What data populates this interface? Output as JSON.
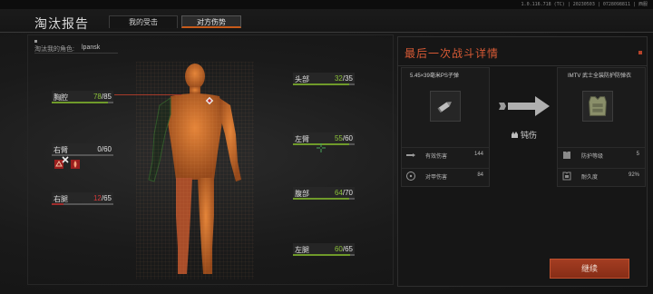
{
  "build_info": "1.0.116.718 (TC) | 20230503 | 0728098811 | 西服",
  "header": {
    "title": "淘汰报告",
    "tabs": [
      {
        "label": "我的受击",
        "active": false
      },
      {
        "label": "对方伤势",
        "active": true
      }
    ]
  },
  "killer": {
    "label": "淘汰我的角色:",
    "name": "lpansk"
  },
  "body_parts": [
    {
      "id": "chest",
      "label": "胸腔",
      "current": 78,
      "max": 85,
      "current_text": "78",
      "max_text": "/85",
      "state": "ok"
    },
    {
      "id": "head",
      "label": "头部",
      "current": 32,
      "max": 35,
      "current_text": "32",
      "max_text": "/35",
      "state": "ok"
    },
    {
      "id": "right_arm",
      "label": "右臂",
      "current": 0,
      "max": 60,
      "current_text": "0",
      "max_text": "/60",
      "state": "destroyed"
    },
    {
      "id": "left_arm",
      "label": "左臂",
      "current": 55,
      "max": 60,
      "current_text": "55",
      "max_text": "/60",
      "state": "ok"
    },
    {
      "id": "right_leg",
      "label": "右腿",
      "current": 12,
      "max": 65,
      "current_text": "12",
      "max_text": "/65",
      "state": "critical"
    },
    {
      "id": "stomach",
      "label": "腹部",
      "current": 64,
      "max": 70,
      "current_text": "64",
      "max_text": "/70",
      "state": "ok"
    },
    {
      "id": "left_leg",
      "label": "左腿",
      "current": 60,
      "max": 65,
      "current_text": "60",
      "max_text": "/65",
      "state": "ok"
    }
  ],
  "last_battle": {
    "title": "最后一次战斗详情",
    "ammo": {
      "name": "5.45×39毫米PS子弹",
      "icon": "bullet-icon",
      "stats": [
        {
          "label": "有效伤害",
          "value": "144",
          "icon": "bullet-damage-icon"
        },
        {
          "label": "对甲伤害",
          "value": "84",
          "icon": "armor-damage-target-icon"
        }
      ]
    },
    "damage_type": {
      "label": "钝伤",
      "icon": "blunt-damage-icon"
    },
    "armor": {
      "name": "IMTV 武士全装防护防弹衣",
      "icon": "body-armor-icon",
      "stats": [
        {
          "label": "防护等级",
          "value": "5",
          "icon": "armor-class-icon"
        },
        {
          "label": "耐久度",
          "value": "92%",
          "icon": "durability-icon"
        }
      ]
    },
    "continue_label": "继续"
  },
  "colors": {
    "accent": "#c75a1a",
    "title_red": "#d85a35",
    "health_green": "#8cc23a",
    "health_red": "#d43b3b",
    "button": "#9a3a20"
  }
}
